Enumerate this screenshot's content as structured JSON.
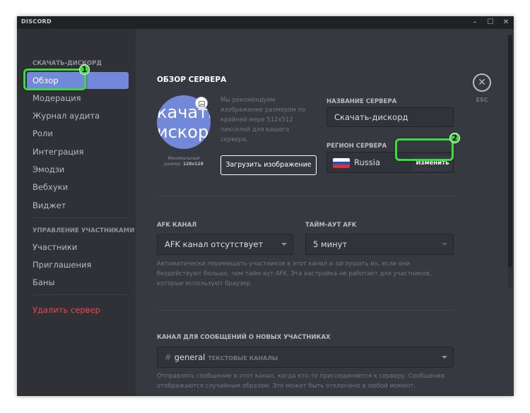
{
  "app_title": "DISCORD",
  "window_controls": {
    "minimize": "–",
    "maximize": "☐",
    "close": "✕"
  },
  "sidebar": {
    "server_header": "СКАЧАТЬ-ДИСКОРД",
    "items": [
      "Обзор",
      "Модерация",
      "Журнал аудита",
      "Роли",
      "Интеграция",
      "Эмодзи",
      "Вебхуки",
      "Виджет"
    ],
    "members_header": "УПРАВЛЕНИЕ УЧАСТНИКАМИ",
    "member_items": [
      "Участники",
      "Приглашения",
      "Баны"
    ],
    "delete_server": "Удалить сервер",
    "active_index": 0
  },
  "overview": {
    "title": "ОБЗОР СЕРВЕРА",
    "avatar_text": "качать\nискорд",
    "avatar_color": "#7289da",
    "min_size_label": "Минимальный",
    "min_size_prefix": "размер:",
    "min_size_value": "128x128",
    "recommend_text": "Мы рекомендуем изображение размером по крайней мере 512x512 пикселей для вашего сервера.",
    "upload_button": "Загрузить изображение",
    "server_name_label": "НАЗВАНИЕ СЕРВЕРА",
    "server_name_value": "Скачать-дискорд",
    "region_label": "РЕГИОН СЕРВЕРА",
    "region_value": "Russia",
    "change_button": "Изменить"
  },
  "afk": {
    "channel_label": "AFK КАНАЛ",
    "channel_value": "AFK канал отсутствует",
    "timeout_label": "ТАЙМ-АУТ AFK",
    "timeout_value": "5 минут",
    "help_text": "Автоматически перемещать участников в этот канал и заглушать их, если они бездействуют больше, чем тайм-аут AFK. Эта настройка не работает для участников, которые используют браузер."
  },
  "welcome": {
    "label": "КАНАЛ ДЛЯ СООБЩЕНИЙ О НОВЫХ УЧАСТНИКАХ",
    "hash": "#",
    "channel": "general",
    "category": "ТЕКСТОВЫЕ КАНАЛЫ",
    "help_text": "Отправлять сообщение в этот канал, когда кто-то присоединяется к серверу. Сообщения отображаются случайным образом. Это может быть отключено в любой момент."
  },
  "esc": {
    "icon": "✕",
    "label": "ESC"
  },
  "annotations": {
    "marker_1": "1",
    "marker_2": "2",
    "highlight_color": "#3ddc3d"
  },
  "colors": {
    "accent": "#7289da",
    "danger": "#f04747",
    "background": "#36393f",
    "sidebar": "#2f3136"
  }
}
